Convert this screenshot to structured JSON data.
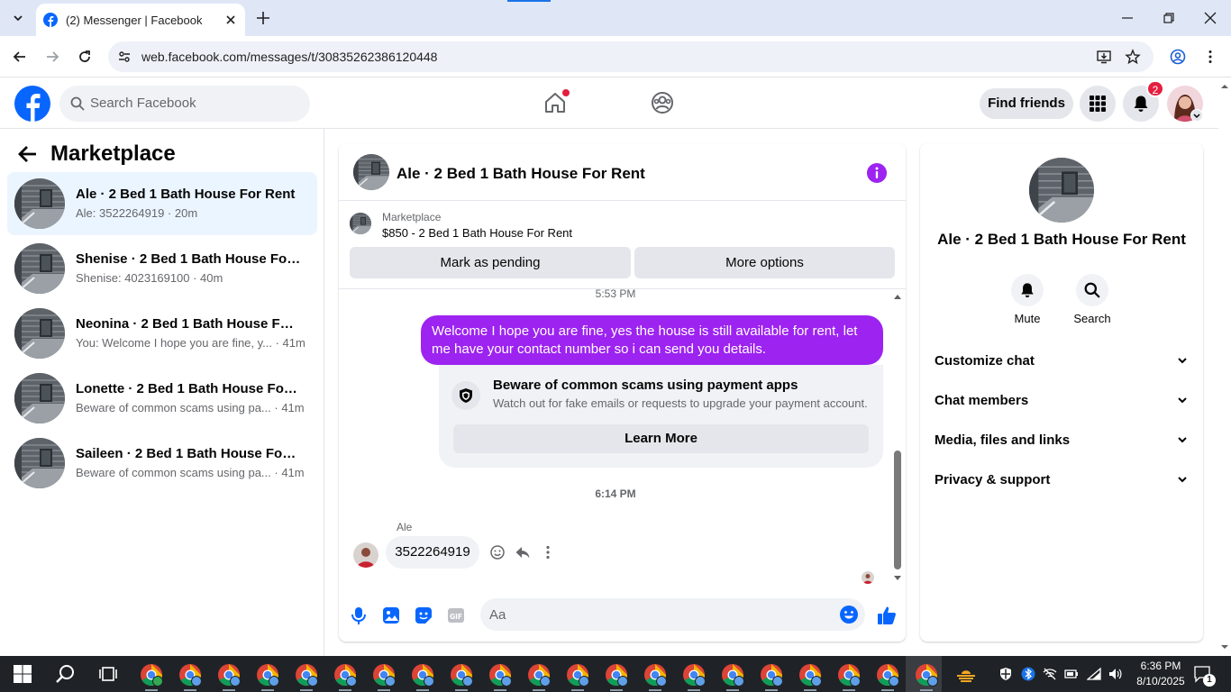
{
  "browser": {
    "tab_title": "(2) Messenger | Facebook",
    "url": "web.facebook.com/messages/t/30835262386120448"
  },
  "header": {
    "search_placeholder": "Search Facebook",
    "find_friends": "Find friends",
    "notification_count": "2"
  },
  "sidebar": {
    "title": "Marketplace",
    "conversations": [
      {
        "name": "Ale · 2 Bed 1 Bath House For Rent",
        "preview": "Ale: 3522264919 · 20m",
        "active": true
      },
      {
        "name": "Shenise · 2 Bed 1 Bath House For R...",
        "preview": "Shenise: 4023169100 · 40m",
        "active": false
      },
      {
        "name": "Neonina · 2 Bed 1 Bath House For ...",
        "preview": "You: Welcome I hope you are fine, y... · 41m",
        "active": false
      },
      {
        "name": "Lonette · 2 Bed 1 Bath House For R...",
        "preview": "Beware of common scams using pa... · 41m",
        "active": false
      },
      {
        "name": "Saileen · 2 Bed 1 Bath House For R...",
        "preview": "Beware of common scams using pa... · 41m",
        "active": false
      }
    ]
  },
  "chat": {
    "title": "Ale · 2 Bed 1 Bath House For Rent",
    "marketplace_label": "Marketplace",
    "listing": "$850 - 2 Bed 1 Bath House For Rent",
    "mark_pending": "Mark as pending",
    "more_options": "More options",
    "time1": "5:53 PM",
    "outgoing_message": "Welcome I hope you are fine, yes the house is still available for rent, let me have your contact number so i can send you  details.",
    "warning_title": "Beware of common scams using payment apps",
    "warning_text": "Watch out for fake emails or requests to upgrade your payment account.",
    "learn_more": "Learn More",
    "time2": "6:14 PM",
    "sender": "Ale",
    "incoming_message": "3522264919",
    "composer_placeholder": "Aa"
  },
  "info_panel": {
    "name": "Ale · 2 Bed 1 Bath House For Rent",
    "mute": "Mute",
    "search": "Search",
    "sections": [
      "Customize chat",
      "Chat members",
      "Media, files and links",
      "Privacy & support"
    ]
  },
  "taskbar": {
    "time": "6:36 PM",
    "date": "8/10/2025",
    "notifications": "1"
  },
  "colors": {
    "fb_blue": "#0866ff",
    "accent_purple": "#9d23f0",
    "active_bg": "#ebf5ff"
  }
}
